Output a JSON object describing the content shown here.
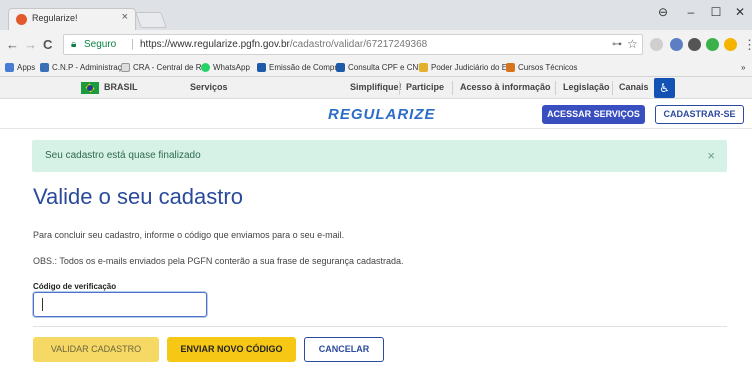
{
  "browser": {
    "tab_title": "Regularize!",
    "tab_close": "×",
    "minimize": "–",
    "maximize": "☐",
    "close": "✕",
    "profile": "⊖",
    "secure_label": "Seguro",
    "url_host": "https://www.regularize.pgfn.gov.br",
    "url_path": "/cadastro/validar/67217249368",
    "back": "←",
    "forward": "→",
    "reload": "C"
  },
  "bookmarks": [
    "Apps",
    "C.N.P - Administraçã",
    "CRA - Central de Re",
    "WhatsApp",
    "Emissão de Compro",
    "Consulta CPF e CNPJ",
    "Poder Judiciário do E",
    "Cursos Técnicos"
  ],
  "bookmarks_more": "»",
  "govbar": {
    "country": "BRASIL",
    "services": "Serviços",
    "links": [
      "Simplifique!",
      "Participe",
      "Acesso à informação",
      "Legislação",
      "Canais"
    ]
  },
  "header": {
    "logo": "REGULARIZE",
    "access_button": "ACESSAR SERVIÇOS",
    "signup_button": "CADASTRAR-SE"
  },
  "alert": {
    "message": "Seu cadastro está quase finalizado",
    "close": "×"
  },
  "main": {
    "title": "Valide o seu cadastro",
    "instructions": "Para concluir seu cadastro, informe o código que enviamos para o seu e-mail.",
    "obs": "OBS.: Todos os e-mails enviados pela PGFN conterão a sua frase de segurança cadastrada.",
    "code_label": "Código de verificação",
    "code_value": "",
    "validate_button": "VALIDAR CADASTRO",
    "resend_button": "ENVIAR NOVO CÓDIGO",
    "cancel_button": "CANCELAR"
  }
}
